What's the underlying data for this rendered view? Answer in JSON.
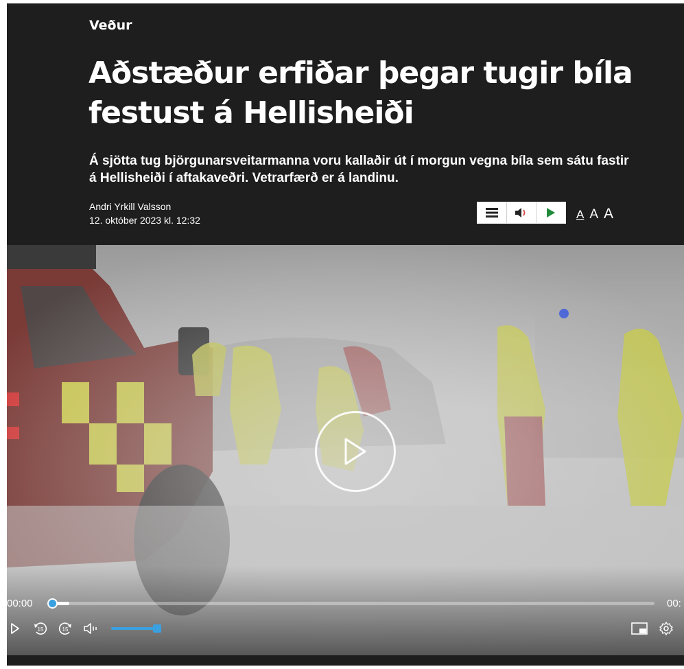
{
  "article": {
    "category": "Veður",
    "headline": "Aðstæður erfiðar þegar tugir bíla festust á Hellisheiði",
    "lead": "Á sjötta tug björgunarsveitarmanna voru kallaðir út í morgun vegna bíla sem sátu fastir á Hellisheiði í aftakaveðri. Vetrarfærð er á landinu.",
    "author": "Andri Yrkill Valsson",
    "date": "12. október 2023 kl. 12:32"
  },
  "audio_bar": {
    "icons": [
      "menu-icon",
      "speaker-icon",
      "play-icon"
    ],
    "accent": "#1f8a3a"
  },
  "font_size": {
    "small": "A",
    "medium": "A",
    "large": "A"
  },
  "video": {
    "time_current": "00:00",
    "time_total": "00:",
    "progress_fraction": 0,
    "volume_fraction": 0.95,
    "rewind_label": "15",
    "forward_label": "15",
    "accent": "#3aa0e0",
    "icons": [
      "play-icon",
      "rewind-15-icon",
      "forward-15-icon",
      "volume-icon",
      "picture-in-picture-icon",
      "settings-icon"
    ]
  }
}
